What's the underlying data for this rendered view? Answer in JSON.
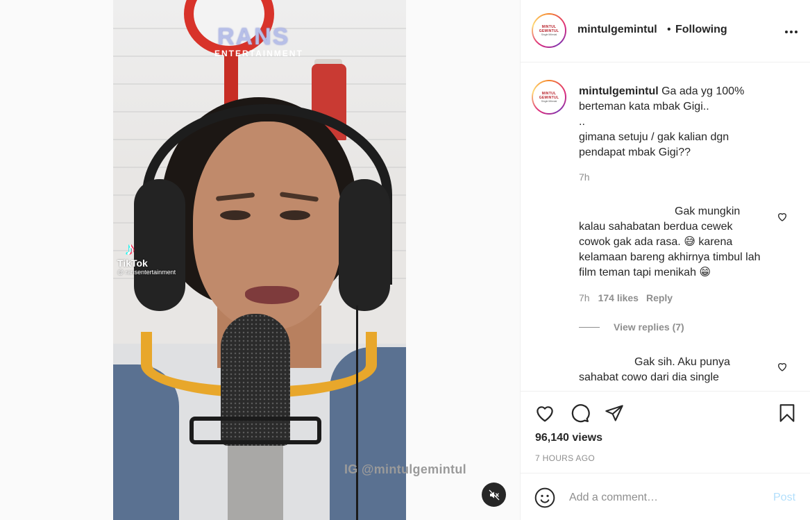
{
  "media": {
    "logo_text": "RANS",
    "logo_sub": "ENTERTAINMENT",
    "tiktok_mark": "♪",
    "tiktok_name": "TikTok",
    "tiktok_user": "@ ransentertainment",
    "watermark": "IG @mintulgemintul",
    "mute_icon": "speaker-muted-icon"
  },
  "header": {
    "username": "mintulgemintul",
    "separator": "•",
    "follow_status": "Following",
    "avatar_line1": "MINTUL GEMINTUL",
    "avatar_line2": "Single Milenial"
  },
  "caption": {
    "username": "mintulgemintul",
    "line1": "Ga ada yg 100% berteman kata mbak Gigi..",
    "line2": "..",
    "line3": "gimana setuju / gak kalian dgn pendapat mbak Gigi??",
    "time": "7h"
  },
  "comments": [
    {
      "text": "Gak mungkin kalau sahabatan berdua cewek cowok gak ada rasa. 😅 karena kelamaan bareng akhirnya timbul lah film teman tapi menikah 😁",
      "time": "7h",
      "likes": "174 likes",
      "reply_label": "Reply",
      "view_replies": "View replies (7)"
    },
    {
      "text": "Gak sih. Aku punya sahabat cowo dari dia single"
    }
  ],
  "actions": {
    "views": "96,140 views",
    "posted": "7 HOURS AGO"
  },
  "add_comment": {
    "placeholder": "Add a comment…",
    "post_label": "Post"
  },
  "colors": {
    "text": "#262626",
    "secondary": "#8e8e8e",
    "post_disabled": "#b2dffc",
    "border": "#efefef"
  }
}
